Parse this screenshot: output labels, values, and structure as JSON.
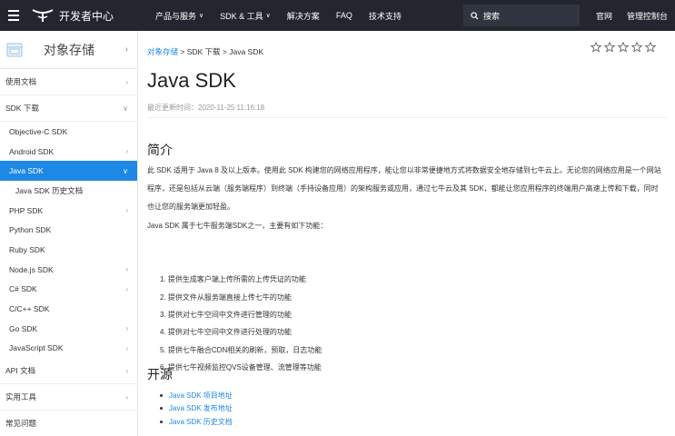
{
  "topbar": {
    "brand": "开发者中心",
    "nav": [
      {
        "label": "产品与服务",
        "caret": true
      },
      {
        "label": "SDK & 工具",
        "caret": true
      },
      {
        "label": "解决方案",
        "caret": false
      },
      {
        "label": "FAQ",
        "caret": false
      },
      {
        "label": "技术支持",
        "caret": false
      }
    ],
    "search_label": "搜索",
    "right_links": [
      "官网",
      "管理控制台"
    ]
  },
  "sidebar": {
    "title": "对象存储",
    "items": [
      {
        "label": "使用文档",
        "level": 1,
        "chevron": "right",
        "active": false
      },
      {
        "label": "SDK 下载",
        "level": 1,
        "chevron": "down",
        "active": false
      },
      {
        "label": "Objective-C SDK",
        "level": 2,
        "chevron": "",
        "active": false
      },
      {
        "label": "Android SDK",
        "level": 2,
        "chevron": "right",
        "active": false
      },
      {
        "label": "Java SDK",
        "level": 2,
        "chevron": "down",
        "active": true
      },
      {
        "label": "Java SDK 历史文档",
        "level": 3,
        "chevron": "",
        "active": false
      },
      {
        "label": "PHP SDK",
        "level": 2,
        "chevron": "right",
        "active": false
      },
      {
        "label": "Python SDK",
        "level": 2,
        "chevron": "",
        "active": false
      },
      {
        "label": "Ruby SDK",
        "level": 2,
        "chevron": "",
        "active": false
      },
      {
        "label": "Node.js SDK",
        "level": 2,
        "chevron": "right",
        "active": false
      },
      {
        "label": "C# SDK",
        "level": 2,
        "chevron": "right",
        "active": false
      },
      {
        "label": "C/C++ SDK",
        "level": 2,
        "chevron": "",
        "active": false
      },
      {
        "label": "Go SDK",
        "level": 2,
        "chevron": "right",
        "active": false
      },
      {
        "label": "JavaScript SDK",
        "level": 2,
        "chevron": "right",
        "active": false
      },
      {
        "label": "API 文档",
        "level": 1,
        "chevron": "right",
        "active": false
      },
      {
        "label": "实用工具",
        "level": 1,
        "chevron": "right",
        "active": false
      },
      {
        "label": "常见问题",
        "level": 1,
        "chevron": "",
        "active": false
      }
    ]
  },
  "main": {
    "breadcrumb": [
      "对象存储",
      "SDK 下载",
      "Java SDK"
    ],
    "breadcrumb_sep": " > ",
    "star_count": 5,
    "title": "Java SDK",
    "updated": "最近更新时间：2020-11-25 11:16:18",
    "intro_heading": "简介",
    "intro_para": "此 SDK 适用于 Java 8 及以上版本。使用此 SDK 构建您的网络应用程序，能让您以非常便捷地方式将数据安全地存储到七牛云上。无论您的网络应用是一个网站程序，还是包括从云端（服务端程序）到终端（手持设备应用）的架构服务或应用，通过七牛云及其 SDK，都能让您应用程序的终端用户高速上传和下载，同时也让您的服务端更加轻盈。",
    "features_intro": "Java SDK 属于七牛服务端SDK之一，主要有如下功能：",
    "features": [
      "1. 提供生成客户端上传所需的上传凭证的功能",
      "2. 提供文件从服务端直接上传七牛的功能",
      "3. 提供对七牛空间中文件进行管理的功能",
      "4. 提供对七牛空间中文件进行处理的功能",
      "5. 提供七牛融合CDN相关的刷新，预取，日志功能",
      "6. 提供七牛视频监控QVS设备管理、流管理等功能"
    ],
    "opensource_heading": "开源",
    "opensource_links": [
      "Java SDK 项目地址",
      "Java SDK 发布地址",
      "Java SDK 历史文档"
    ]
  }
}
